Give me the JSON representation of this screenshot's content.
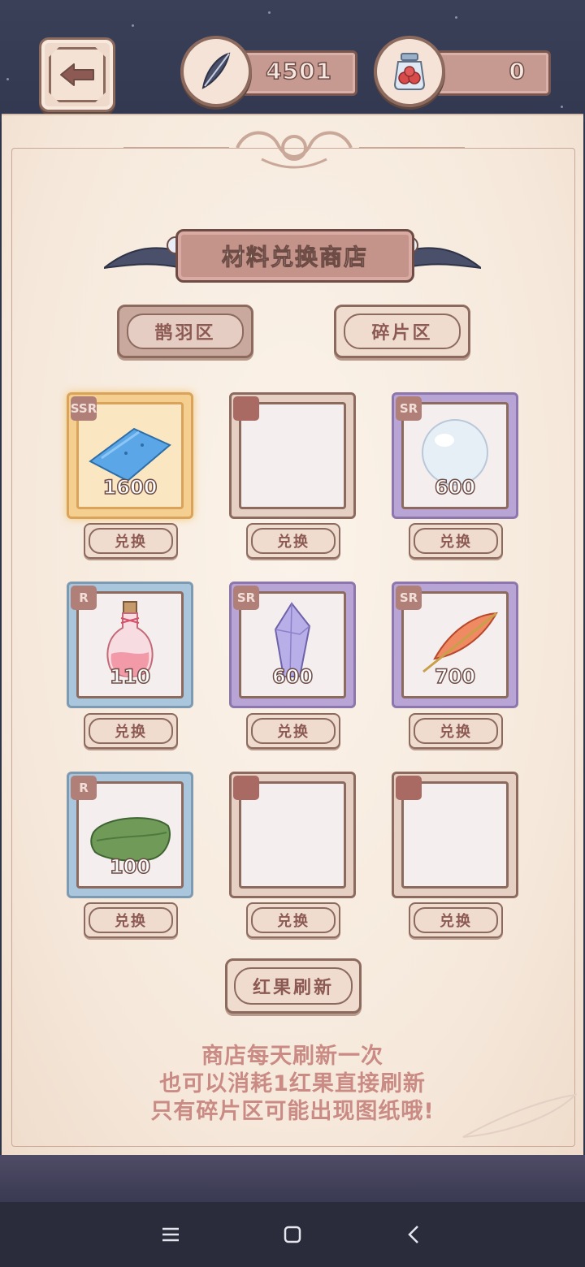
{
  "header": {
    "feather_count": "4501",
    "fruit_count": "0"
  },
  "title": "材料兑换商店",
  "tabs": [
    {
      "label": "鹊羽区",
      "active": true
    },
    {
      "label": "碎片区",
      "active": false
    }
  ],
  "items": [
    {
      "rarity": "SSR",
      "price": "1600",
      "icon": "blue-cloth-icon"
    },
    {
      "rarity": "",
      "price": "",
      "icon": ""
    },
    {
      "rarity": "SR",
      "price": "600",
      "icon": "crystal-orb-icon"
    },
    {
      "rarity": "R",
      "price": "110",
      "icon": "potion-bottle-icon"
    },
    {
      "rarity": "SR",
      "price": "600",
      "icon": "purple-crystal-icon"
    },
    {
      "rarity": "SR",
      "price": "700",
      "icon": "red-feather-icon"
    },
    {
      "rarity": "R",
      "price": "100",
      "icon": "green-cloth-icon"
    },
    {
      "rarity": "",
      "price": "",
      "icon": ""
    },
    {
      "rarity": "",
      "price": "",
      "icon": ""
    }
  ],
  "exchange_label": "兑换",
  "refresh_label": "红果刷新",
  "notice": [
    "商店每天刷新一次",
    "也可以消耗1红果直接刷新",
    "只有碎片区可能出现图纸哦!"
  ],
  "colors": {
    "accent": "#c4948b",
    "outline": "#8c6a5e",
    "notice_text": "#c98b84"
  }
}
